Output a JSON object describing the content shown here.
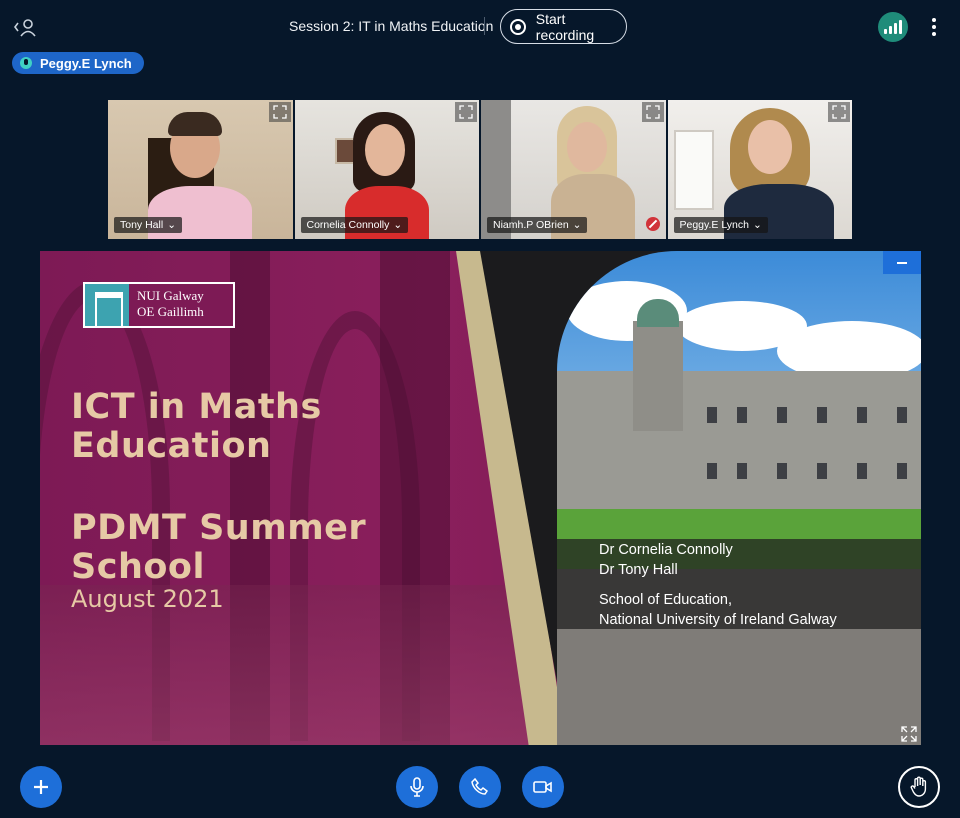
{
  "header": {
    "session_title": "Session 2: IT in Maths Education",
    "record_label": "Start recording"
  },
  "talking_indicator": {
    "name": "Peggy.E Lynch"
  },
  "participants": [
    {
      "name": "Tony Hall",
      "muted": false
    },
    {
      "name": "Cornelia Connolly",
      "muted": false
    },
    {
      "name": "Niamh.P OBrien",
      "muted": true
    },
    {
      "name": "Peggy.E Lynch",
      "muted": false,
      "active": true
    }
  ],
  "slide": {
    "logo_line1": "NUI Galway",
    "logo_line2": "OE Gaillimh",
    "title_line1": "ICT in Maths",
    "title_line2": "Education",
    "subtitle_line1": "PDMT Summer",
    "subtitle_line2": "School",
    "date": "August 2021",
    "presenter1": "Dr Cornelia Connolly",
    "presenter2": "Dr Tony Hall",
    "institution_line1": "School of Education,",
    "institution_line2": "National University of Ireland Galway"
  },
  "colors": {
    "background": "#06172a",
    "accent_blue": "#1e6fd9",
    "slide_maroon": "#7d1a55",
    "slide_gold_text": "#e6c9a5",
    "stats_green": "#1f8c7a"
  }
}
